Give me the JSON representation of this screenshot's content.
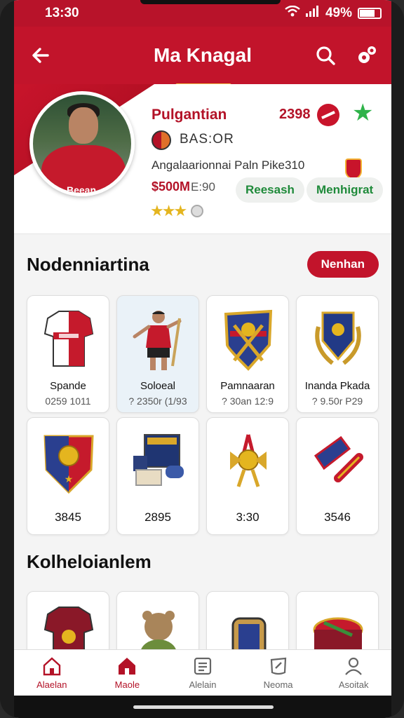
{
  "status": {
    "time": "13:30",
    "battery": "49%"
  },
  "appbar": {
    "title": "Ma Knagal",
    "back_icon": "arrow-left-icon",
    "search_icon": "search-icon",
    "settings_icon": "gear-icon"
  },
  "profile": {
    "name": "Pulgantian",
    "score": "2398",
    "subtitle": "BAS:OR",
    "club": "Angalaarionnai Paln Pike310",
    "value": "$500M",
    "value_extra": "E:90",
    "pill_1": "Reesash",
    "pill_2": "Menhigrat",
    "stars": "★★★",
    "shirt_text": "Beean"
  },
  "section1": {
    "title": "Nodenniartina",
    "button": "Nenhan",
    "cards": [
      {
        "label": "Spande",
        "sub": "0259 1011"
      },
      {
        "label": "Soloeal",
        "sub": "? 2350r (1/93"
      },
      {
        "label": "Pamnaaran",
        "sub": "? 30an 12:9"
      },
      {
        "label": "Inanda Pkada",
        "sub": "? 9.50r P29"
      },
      {
        "value": "3845"
      },
      {
        "value": "2895"
      },
      {
        "value": "3:30"
      },
      {
        "value": "3546"
      }
    ]
  },
  "section2": {
    "title": "Kolheloianlem"
  },
  "bottom_nav": {
    "items": [
      {
        "label": "Alaelan",
        "icon": "home-icon"
      },
      {
        "label": "Maole",
        "icon": "shop-icon"
      },
      {
        "label": "Alelain",
        "icon": "list-icon"
      },
      {
        "label": "Neoma",
        "icon": "edit-icon"
      },
      {
        "label": "Asoitak",
        "icon": "profile-icon"
      }
    ]
  },
  "colors": {
    "primary": "#c2142b",
    "accent_green": "#1f8a3a",
    "gold": "#e4b51f"
  }
}
